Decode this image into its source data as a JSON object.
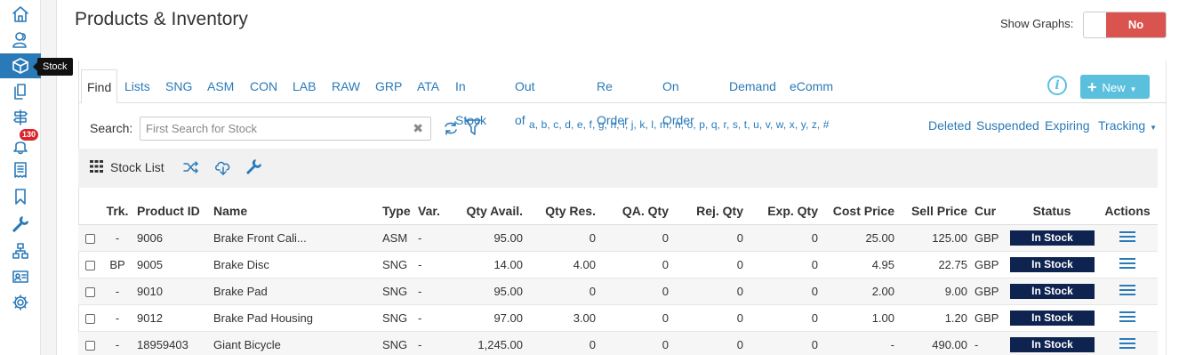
{
  "sidebar": {
    "items": [
      {
        "icon": "home-icon"
      },
      {
        "icon": "users-icon"
      },
      {
        "icon": "box-icon",
        "active": true
      },
      {
        "icon": "documents-icon"
      },
      {
        "icon": "signpost-icon"
      },
      {
        "icon": "bell-icon"
      },
      {
        "icon": "receipt-icon"
      },
      {
        "icon": "bookmark-icon"
      },
      {
        "icon": "wrench-icon"
      },
      {
        "icon": "sitemap-icon"
      },
      {
        "icon": "id-card-icon"
      },
      {
        "icon": "gear-icon"
      }
    ],
    "tooltip": "Stock",
    "notification_count": "130"
  },
  "header": {
    "title": "Products & Inventory",
    "show_graphs_label": "Show Graphs:",
    "show_graphs_value": "No"
  },
  "tabs": [
    "Find",
    "Lists",
    "SNG",
    "ASM",
    "CON",
    "LAB",
    "RAW",
    "GRP",
    "ATA",
    "In Stock",
    "Out of Stock",
    "Re Order",
    "On Order",
    "Demand",
    "eComm"
  ],
  "new_button": {
    "label": "New"
  },
  "search": {
    "label": "Search:",
    "placeholder": "First Search for Stock",
    "value": "",
    "alphabet": "a, b, c, d, e, f, g, h, i, j, k, l, m, n, o, p, q, r, s, t, u, v, w, x, y, z, #",
    "links": [
      "Deleted",
      "Suspended",
      "Expiring",
      "Tracking"
    ]
  },
  "list": {
    "title": "Stock List"
  },
  "table": {
    "columns": [
      "",
      "Trk.",
      "Product ID",
      "Name",
      "Type",
      "Var.",
      "Qty Avail.",
      "Qty Res.",
      "QA. Qty",
      "Rej. Qty",
      "Exp. Qty",
      "Cost Price",
      "Sell Price",
      "Cur",
      "Status",
      "Actions"
    ],
    "rows": [
      {
        "trk": "-",
        "id": "9006",
        "name": "Brake Front Cali...",
        "type": "ASM",
        "var": "-",
        "avail": "95.00",
        "res": "0",
        "qa": "0",
        "rej": "0",
        "exp": "0",
        "cost": "25.00",
        "sell": "125.00",
        "cur": "GBP",
        "status": "In Stock"
      },
      {
        "trk": "BP",
        "id": "9005",
        "name": "Brake Disc",
        "type": "SNG",
        "var": "-",
        "avail": "14.00",
        "res": "4.00",
        "qa": "0",
        "rej": "0",
        "exp": "0",
        "cost": "4.95",
        "sell": "22.75",
        "cur": "GBP",
        "status": "In Stock"
      },
      {
        "trk": "-",
        "id": "9010",
        "name": "Brake Pad",
        "type": "SNG",
        "var": "-",
        "avail": "95.00",
        "res": "0",
        "qa": "0",
        "rej": "0",
        "exp": "0",
        "cost": "2.00",
        "sell": "9.00",
        "cur": "GBP",
        "status": "In Stock"
      },
      {
        "trk": "-",
        "id": "9012",
        "name": "Brake Pad Housing",
        "type": "SNG",
        "var": "-",
        "avail": "97.00",
        "res": "3.00",
        "qa": "0",
        "rej": "0",
        "exp": "0",
        "cost": "1.00",
        "sell": "1.20",
        "cur": "GBP",
        "status": "In Stock"
      },
      {
        "trk": "-",
        "id": "18959403",
        "name": "Giant Bicycle",
        "type": "SNG",
        "var": "-",
        "avail": "1,245.00",
        "res": "0",
        "qa": "0",
        "rej": "0",
        "exp": "0",
        "cost": "-",
        "sell": "490.00",
        "cur": "-",
        "status": "In Stock"
      }
    ]
  },
  "colors": {
    "accent": "#2a7ab8",
    "toggle_no": "#d9534f",
    "new_button": "#5bc0de",
    "status": "#0f2350",
    "badge": "#d9242b"
  }
}
